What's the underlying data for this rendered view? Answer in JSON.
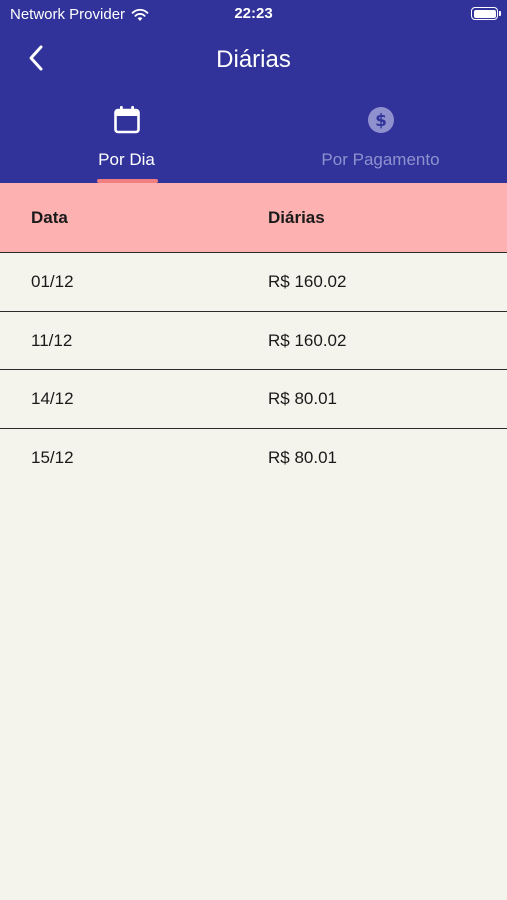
{
  "status_bar": {
    "carrier": "Network Provider",
    "time": "22:23"
  },
  "header": {
    "title": "Diárias",
    "back_icon": "chevron-left-icon"
  },
  "tabs": [
    {
      "label": "Por Dia",
      "icon": "calendar-icon",
      "active": true
    },
    {
      "label": "Por Pagamento",
      "icon": "dollar-circle-icon",
      "active": false
    }
  ],
  "table": {
    "columns": [
      "Data",
      "Diárias"
    ],
    "rows": [
      {
        "date": "01/12",
        "value": "R$ 160.02"
      },
      {
        "date": "11/12",
        "value": "R$ 160.02"
      },
      {
        "date": "14/12",
        "value": "R$ 80.01"
      },
      {
        "date": "15/12",
        "value": "R$ 80.01"
      }
    ]
  },
  "colors": {
    "header_bg": "#31339a",
    "tab_indicator": "#f27f7f",
    "table_header_bg": "#fdb1b0",
    "page_bg": "#f4f3ec",
    "inactive_tab": "#8f91cf"
  }
}
